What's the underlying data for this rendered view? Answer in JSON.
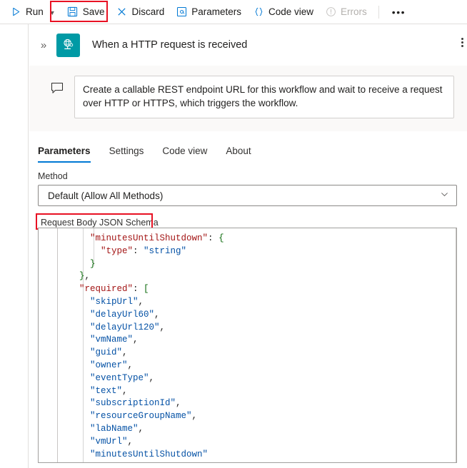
{
  "toolbar": {
    "items": [
      {
        "label": "Run",
        "icon": "play-icon",
        "has_caret": true,
        "disabled": false
      },
      {
        "label": "Save",
        "icon": "save-disk-icon",
        "has_caret": false,
        "disabled": false
      },
      {
        "label": "Discard",
        "icon": "close-x-icon",
        "has_caret": false,
        "disabled": false
      },
      {
        "label": "Parameters",
        "icon": "at-sign-icon",
        "has_caret": false,
        "disabled": false
      },
      {
        "label": "Code view",
        "icon": "curly-braces-icon",
        "has_caret": false,
        "disabled": false
      },
      {
        "label": "Errors",
        "icon": "alert-circle-icon",
        "has_caret": false,
        "disabled": true
      }
    ],
    "overflow_label": "•••",
    "highlight_color": "#e81123",
    "accent_color": "#0078d4"
  },
  "card": {
    "expand_icon": "chevron-double-right-icon",
    "node_icon": "http-request-globe-icon",
    "node_icon_color": "#009aa5",
    "title": "When a HTTP request is received",
    "kebab_icon": "more-vertical-icon",
    "comment_icon": "comment-bubble-icon",
    "description": "Create a callable REST endpoint URL for this workflow and wait to receive a request over HTTP or HTTPS, which triggers the workflow."
  },
  "tabs": [
    {
      "label": "Parameters",
      "active": true
    },
    {
      "label": "Settings",
      "active": false
    },
    {
      "label": "Code view",
      "active": false
    },
    {
      "label": "About",
      "active": false
    }
  ],
  "method_field": {
    "label": "Method",
    "value": "Default (Allow All Methods)",
    "caret_icon": "chevron-down-icon"
  },
  "schema_field": {
    "label": "Request Body JSON Schema",
    "annotated": true,
    "annotation_color": "#e81123"
  },
  "code_editor": {
    "language": "json",
    "lines": [
      {
        "indent": 6,
        "tokens": [
          {
            "t": "\"minutesUntilShutdown\"",
            "c": "k"
          },
          {
            "t": ": ",
            "c": "b"
          },
          {
            "t": "{",
            "c": "p"
          }
        ]
      },
      {
        "indent": 8,
        "tokens": [
          {
            "t": "\"type\"",
            "c": "k"
          },
          {
            "t": ": ",
            "c": "b"
          },
          {
            "t": "\"string\"",
            "c": "s"
          }
        ]
      },
      {
        "indent": 6,
        "tokens": [
          {
            "t": "}",
            "c": "p"
          }
        ]
      },
      {
        "indent": 4,
        "tokens": [
          {
            "t": "}",
            "c": "p"
          },
          {
            "t": ",",
            "c": "b"
          }
        ]
      },
      {
        "indent": 4,
        "tokens": [
          {
            "t": "\"required\"",
            "c": "k"
          },
          {
            "t": ": ",
            "c": "b"
          },
          {
            "t": "[",
            "c": "p"
          }
        ]
      },
      {
        "indent": 6,
        "tokens": [
          {
            "t": "\"skipUrl\"",
            "c": "s"
          },
          {
            "t": ",",
            "c": "b"
          }
        ]
      },
      {
        "indent": 6,
        "tokens": [
          {
            "t": "\"delayUrl60\"",
            "c": "s"
          },
          {
            "t": ",",
            "c": "b"
          }
        ]
      },
      {
        "indent": 6,
        "tokens": [
          {
            "t": "\"delayUrl120\"",
            "c": "s"
          },
          {
            "t": ",",
            "c": "b"
          }
        ]
      },
      {
        "indent": 6,
        "tokens": [
          {
            "t": "\"vmName\"",
            "c": "s"
          },
          {
            "t": ",",
            "c": "b"
          }
        ]
      },
      {
        "indent": 6,
        "tokens": [
          {
            "t": "\"guid\"",
            "c": "s"
          },
          {
            "t": ",",
            "c": "b"
          }
        ]
      },
      {
        "indent": 6,
        "tokens": [
          {
            "t": "\"owner\"",
            "c": "s"
          },
          {
            "t": ",",
            "c": "b"
          }
        ]
      },
      {
        "indent": 6,
        "tokens": [
          {
            "t": "\"eventType\"",
            "c": "s"
          },
          {
            "t": ",",
            "c": "b"
          }
        ]
      },
      {
        "indent": 6,
        "tokens": [
          {
            "t": "\"text\"",
            "c": "s"
          },
          {
            "t": ",",
            "c": "b"
          }
        ]
      },
      {
        "indent": 6,
        "tokens": [
          {
            "t": "\"subscriptionId\"",
            "c": "s"
          },
          {
            "t": ",",
            "c": "b"
          }
        ]
      },
      {
        "indent": 6,
        "tokens": [
          {
            "t": "\"resourceGroupName\"",
            "c": "s"
          },
          {
            "t": ",",
            "c": "b"
          }
        ]
      },
      {
        "indent": 6,
        "tokens": [
          {
            "t": "\"labName\"",
            "c": "s"
          },
          {
            "t": ",",
            "c": "b"
          }
        ]
      },
      {
        "indent": 6,
        "tokens": [
          {
            "t": "\"vmUrl\"",
            "c": "s"
          },
          {
            "t": ",",
            "c": "b"
          }
        ]
      },
      {
        "indent": 6,
        "tokens": [
          {
            "t": "\"minutesUntilShutdown\"",
            "c": "s"
          }
        ]
      }
    ]
  }
}
